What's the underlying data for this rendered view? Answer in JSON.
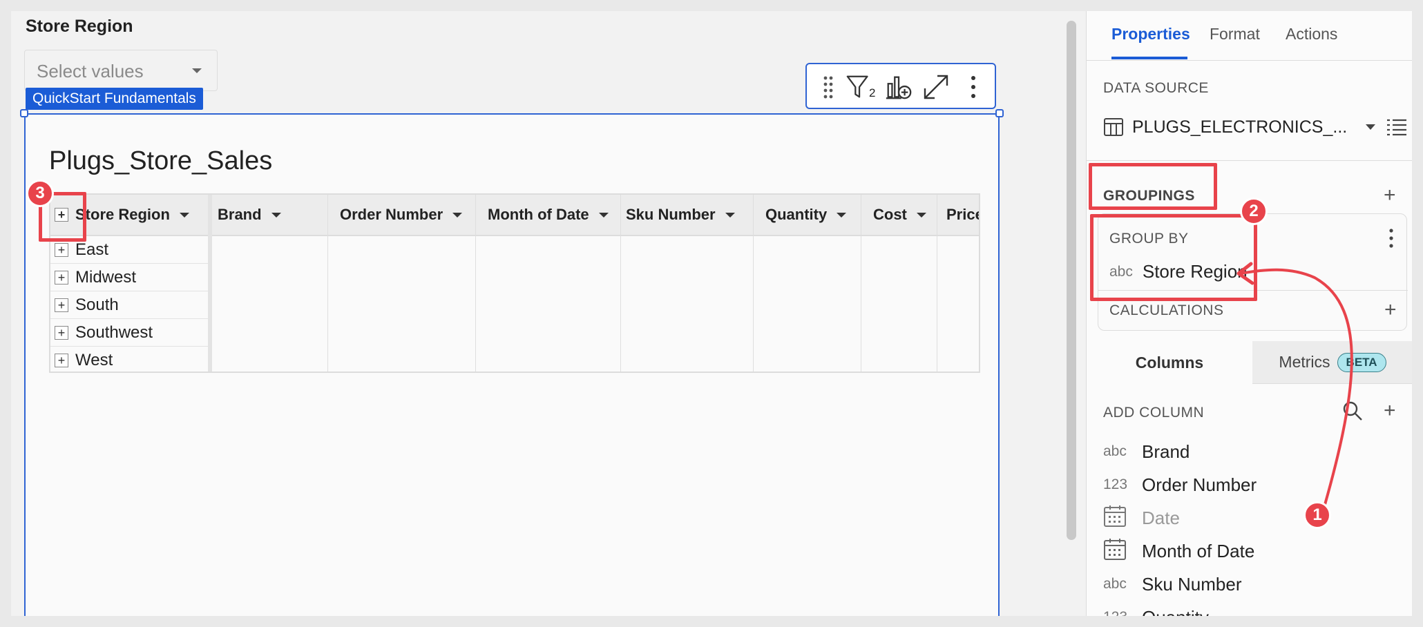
{
  "control": {
    "title": "Store Region",
    "placeholder": "Select values",
    "workbook_tag": "QuickStart Fundamentals"
  },
  "toolbar": {
    "filter_count": "2"
  },
  "table": {
    "title": "Plugs_Store_Sales",
    "columns": [
      "Store Region",
      "Brand",
      "Order Number",
      "Month of Date",
      "Sku Number",
      "Quantity",
      "Cost",
      "Price"
    ],
    "groups": [
      "East",
      "Midwest",
      "South",
      "Southwest",
      "West"
    ]
  },
  "panel": {
    "tabs": [
      "Properties",
      "Format",
      "Actions"
    ],
    "active_tab": "Properties",
    "data_source_label": "DATA SOURCE",
    "data_source_name": "PLUGS_ELECTRONICS_...",
    "groupings_label": "GROUPINGS",
    "group_by_label": "GROUP BY",
    "group_by_field": {
      "type": "abc",
      "name": "Store Region"
    },
    "calculations_label": "CALCULATIONS",
    "subtabs": [
      "Columns",
      "Metrics"
    ],
    "beta_label": "BETA",
    "add_column_label": "ADD COLUMN",
    "columns": [
      {
        "type": "abc",
        "name": "Brand"
      },
      {
        "type": "123",
        "name": "Order Number"
      },
      {
        "type": "calendar",
        "name": "Date",
        "muted": true
      },
      {
        "type": "calendar",
        "name": "Month of Date"
      },
      {
        "type": "abc",
        "name": "Sku Number"
      },
      {
        "type": "123",
        "name": "Quantity"
      }
    ]
  },
  "annotations": {
    "badges": [
      "1",
      "2",
      "3"
    ],
    "color": "#e8434b"
  }
}
